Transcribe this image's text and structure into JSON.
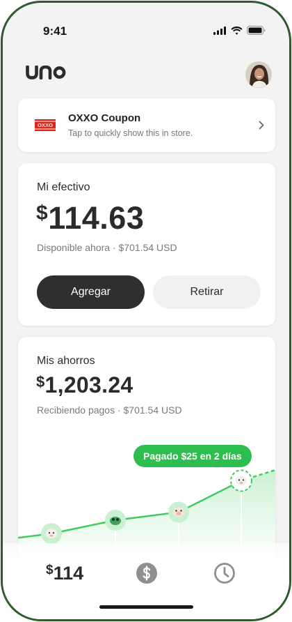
{
  "status_bar": {
    "time": "9:41"
  },
  "header": {
    "logo_text": "uno"
  },
  "coupon": {
    "logo_text": "OXXO",
    "title": "OXXO Coupon",
    "subtitle": "Tap to quickly show this in store."
  },
  "cash": {
    "title": "Mi efectivo",
    "currency": "$",
    "amount": "114.63",
    "subtitle": "Disponible ahora · $701.54 USD",
    "add_label": "Agregar",
    "withdraw_label": "Retirar"
  },
  "savings": {
    "title": "Mis ahorros",
    "currency": "$",
    "amount": "1,203.24",
    "subtitle": "Recibiendo pagos · $701.54 USD",
    "tooltip": "Pagado $25 en 2 días"
  },
  "chart_data": {
    "type": "line",
    "title": "",
    "xlabel": "",
    "ylabel": "",
    "points": [
      {
        "index": 0,
        "level": 0.05,
        "marker": "sheep"
      },
      {
        "index": 1,
        "level": 0.25,
        "marker": "turtle"
      },
      {
        "index": 2,
        "level": 0.37,
        "marker": "pig"
      },
      {
        "index": 3,
        "level": 0.84,
        "marker": "sheep-highlighted"
      },
      {
        "index": 4,
        "level": 1.0,
        "marker": "none",
        "projected": true
      }
    ],
    "colors": {
      "line": "#3ecb5f",
      "fill": "#d8f5dd",
      "marker_bg": "#c9f0d1"
    }
  },
  "nav": {
    "balance_currency": "$",
    "balance_amount": "114",
    "items": [
      "dollar-icon",
      "clock-icon"
    ]
  },
  "colors": {
    "accent": "#2ebd4f",
    "frame": "#2e5a2c",
    "dark_button": "#2f2f2f"
  }
}
